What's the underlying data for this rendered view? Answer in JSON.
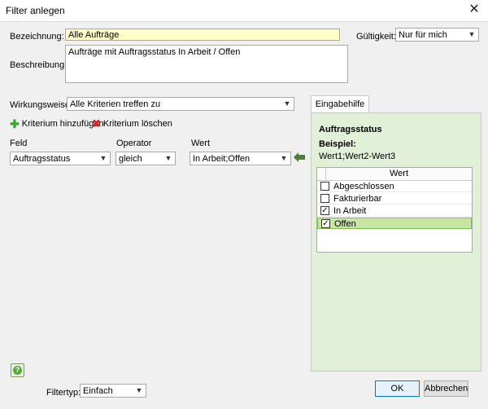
{
  "window": {
    "title": "Filter anlegen",
    "close_glyph": "✕"
  },
  "bezeichnung": {
    "label": "Bezeichnung:",
    "value": "Alle Aufträge"
  },
  "gueltigkeit": {
    "label": "Gültigkeit:",
    "value": "Nur für mich"
  },
  "beschreibung": {
    "label": "Beschreibung:",
    "value": "Aufträge mit Auftragsstatus In Arbeit / Offen"
  },
  "wirkungsweise": {
    "label": "Wirkungsweise:",
    "value": "Alle Kriterien treffen zu"
  },
  "actions": {
    "add_label": "Kriterium hinzufügen",
    "delete_label": "Kriterium löschen"
  },
  "criteria": {
    "headers": {
      "field": "Feld",
      "operator": "Operator",
      "value": "Wert"
    },
    "row": {
      "field": "Auftragsstatus",
      "operator": "gleich",
      "value": "In Arbeit;Offen"
    }
  },
  "helper": {
    "tab_label": "Eingabehilfe",
    "heading": "Auftragsstatus",
    "example_label": "Beispiel:",
    "example_value": "Wert1;Wert2-Wert3",
    "column_header": "Wert",
    "options": [
      {
        "label": "Abgeschlossen",
        "checked": false
      },
      {
        "label": "Fakturierbar",
        "checked": false
      },
      {
        "label": "In Arbeit",
        "checked": true
      },
      {
        "label": "Offen",
        "checked": true
      }
    ]
  },
  "footer": {
    "help_glyph": "?",
    "filtertyp_label": "Filtertyp:",
    "filtertyp_value": "Einfach",
    "ok_label": "OK",
    "cancel_label": "Abbrechen"
  },
  "icons": {
    "add": "plus-icon",
    "delete": "x-icon",
    "apply": "arrow-left-icon",
    "help": "question-icon",
    "dropdown": "chevron-down-icon"
  },
  "colors": {
    "required_field_bg": "#ffffc8",
    "helper_panel_bg": "#e3f0d8",
    "selected_row_bg": "#c6e6a4",
    "add_icon": "#3aa62f",
    "delete_icon": "#d62a2a",
    "default_button_border": "#0078d7"
  }
}
